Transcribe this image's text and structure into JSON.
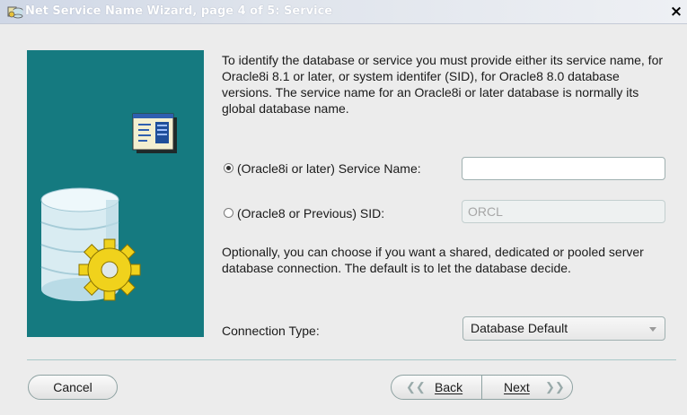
{
  "window": {
    "title": "Net Service Name Wizard, page 4 of 5: Service",
    "close_label": "×"
  },
  "intro_text": "To identify the database or service you must provide either its service name, for Oracle8i 8.1 or later, or system identifer (SID), for Oracle8 8.0 database versions. The service name for an Oracle8i or later database is normally its global database name.",
  "service_option": {
    "label": "(Oracle8i or later)  Service Name:",
    "selected": true,
    "value": ""
  },
  "sid_option": {
    "label": "(Oracle8 or Previous) SID:",
    "selected": false,
    "value": "ORCL"
  },
  "connection_text": "Optionally, you can choose if you want a shared, dedicated or pooled server database connection. The default is to let the database decide.",
  "connection_type": {
    "label": "Connection Type:",
    "value": "Database Default"
  },
  "buttons": {
    "cancel": "Cancel",
    "back": "Back",
    "next": "Next"
  }
}
